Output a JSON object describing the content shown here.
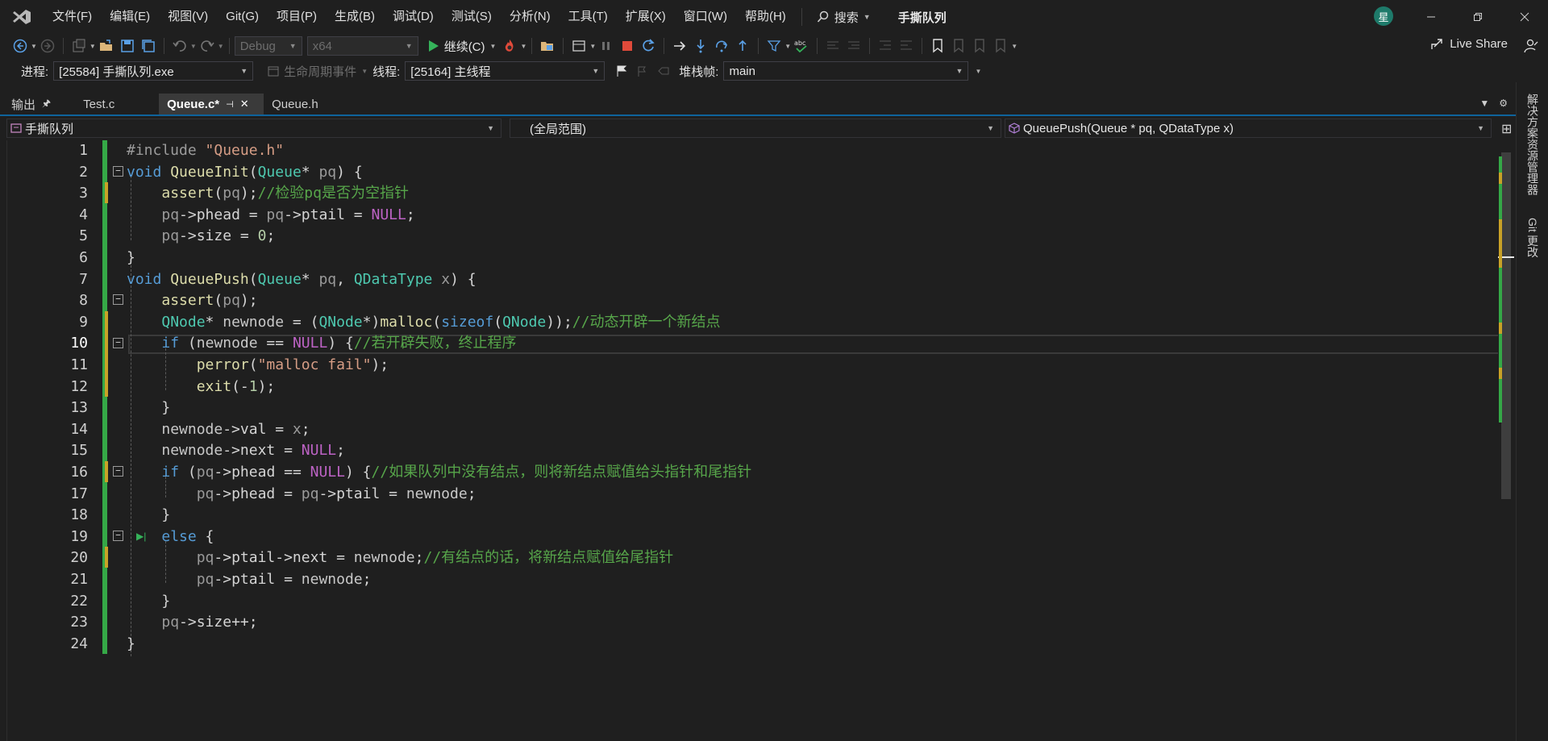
{
  "menu": {
    "items": [
      "文件(F)",
      "编辑(E)",
      "视图(V)",
      "Git(G)",
      "项目(P)",
      "生成(B)",
      "调试(D)",
      "测试(S)",
      "分析(N)",
      "工具(T)",
      "扩展(X)",
      "窗口(W)",
      "帮助(H)"
    ],
    "search_label": "搜索",
    "solution_title": "手撕队列",
    "avatar_initial": "星"
  },
  "toolbar": {
    "config": "Debug",
    "platform": "x64",
    "continue_label": "继续(C)",
    "live_share": "Live Share"
  },
  "debug_bar": {
    "process_label": "进程:",
    "process_value": "[25584] 手撕队列.exe",
    "lifecycle_label": "生命周期事件",
    "thread_label": "线程:",
    "thread_value": "[25164] 主线程",
    "stack_label": "堆栈帧:",
    "stack_value": "main"
  },
  "tabs": {
    "output": "输出",
    "files": [
      {
        "label": "Test.c",
        "active": false
      },
      {
        "label": "Queue.c*",
        "active": true
      },
      {
        "label": "Queue.h",
        "active": false
      }
    ]
  },
  "navbar": {
    "project": "手撕队列",
    "scope": "(全局范围)",
    "member": "QueuePush(Queue * pq, QDataType x)"
  },
  "editor": {
    "current_line": 10,
    "line_numbers": [
      "1",
      "2",
      "3",
      "4",
      "5",
      "6",
      "7",
      "8",
      "9",
      "10",
      "11",
      "12",
      "13",
      "14",
      "15",
      "16",
      "17",
      "18",
      "19",
      "20",
      "21",
      "22",
      "23",
      "24"
    ],
    "lines": [
      "#include \"Queue.h\"",
      "void QueueInit(Queue* pq) {",
      "    assert(pq);//检验pq是否为空指针",
      "    pq->phead = pq->ptail = NULL;",
      "    pq->size = 0;",
      "}",
      "void QueuePush(Queue* pq, QDataType x) {",
      "    assert(pq);",
      "    QNode* newnode = (QNode*)malloc(sizeof(QNode));//动态开辟一个新结点",
      "    if (newnode == NULL) {//若开辟失败，终止程序",
      "        perror(\"malloc fail\");",
      "        exit(-1);",
      "    }",
      "    newnode->val = x;",
      "    newnode->next = NULL;",
      "    if (pq->phead == NULL) {//如果队列中没有结点，则将新结点赋值给头指针和尾指针",
      "        pq->phead = pq->ptail = newnode;",
      "    }",
      "    else {",
      "        pq->ptail->next = newnode;//有结点的话，将新结点赋值给尾指针",
      "        pq->ptail = newnode;",
      "    }",
      "    pq->size++;",
      "}"
    ]
  },
  "right_panel": {
    "solution_explorer": "解决方案资源管理器",
    "git_changes": "Git 更改"
  },
  "colors": {
    "background": "#1f1f1f",
    "keyword": "#569cd6",
    "type": "#4ec9b0",
    "function": "#dcdcaa",
    "string": "#d69d85",
    "comment": "#57a64a",
    "change_saved": "#35a847",
    "change_unsaved": "#c9a227"
  }
}
